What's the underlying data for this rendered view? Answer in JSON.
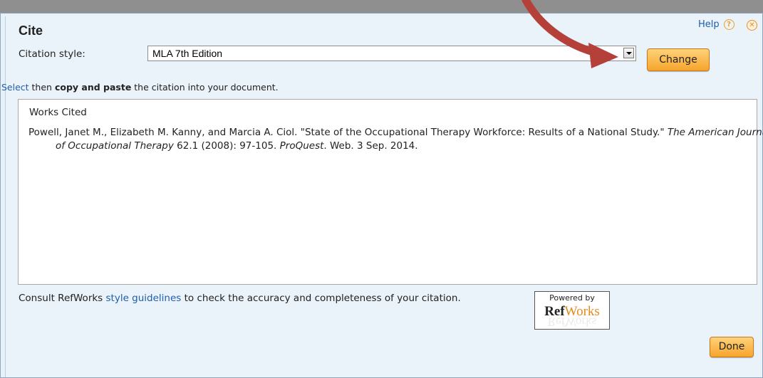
{
  "dialog": {
    "title": "Cite",
    "help_label": "Help",
    "citation_style_label": "Citation style:",
    "citation_style_value": "MLA 7th Edition",
    "change_button": "Change",
    "instructions": {
      "select_link": "Select",
      "text_then": " then ",
      "bold": "copy and paste",
      "text_rest": " the citation into your document."
    },
    "works_cited_heading": "Works Cited",
    "citation": {
      "part1": "Powell, Janet M., Elizabeth M. Kanny, and Marcia A. Ciol. \"State of the Occupational Therapy Workforce: Results of a National Study.\" ",
      "journal": "The American Journal of Occupational Therapy",
      "part2": " 62.1 (2008): 97-105. ",
      "database": "ProQuest",
      "part3": ". Web. 3 Sep. 2014."
    },
    "consult": {
      "prefix": "Consult RefWorks ",
      "link": "style guidelines",
      "suffix": " to check the accuracy and completeness of your citation."
    },
    "refworks_badge": {
      "powered_by": "Powered by",
      "ref": "Ref",
      "works": "Works"
    },
    "done_button": "Done"
  },
  "icons": {
    "help": "help-circle-icon",
    "close": "close-circle-icon",
    "dropdown": "chevron-down-icon",
    "annotation": "red-arrow-icon"
  },
  "colors": {
    "button_orange": "#f6a52c",
    "link_blue": "#1f5fa8",
    "dialog_bg": "#eaf2fa",
    "arrow_red": "#b5403a"
  }
}
